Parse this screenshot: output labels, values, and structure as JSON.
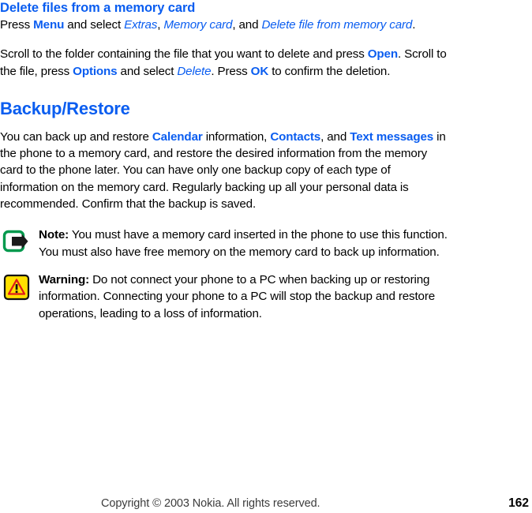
{
  "document": {
    "theme": {
      "link_blue": "#0a5df0",
      "text_black": "#000000",
      "note_icon_green": "#00994d",
      "warning_icon_yellow": "#ffe000",
      "warning_icon_red": "#e01b1b",
      "page_background": "#ffffff"
    }
  },
  "section_delete": {
    "heading": "Delete files from a memory card",
    "paragraph1": {
      "t1": "Press ",
      "menu": "Menu",
      "t2": " and select ",
      "extras": "Extras",
      "t3": ", ",
      "memory_card": "Memory card",
      "t4": ", and ",
      "delete_file": "Delete file from memory card",
      "t5": "."
    },
    "paragraph2": {
      "t1": "Scroll to the folder containing the file that you want to delete and press ",
      "open": "Open",
      "t2": ". Scroll to the file, press ",
      "options": "Options",
      "t3": " and select ",
      "delete": "Delete",
      "t4": ". Press ",
      "ok": "OK",
      "t5": " to confirm the deletion."
    }
  },
  "section_backup": {
    "heading": "Backup/Restore",
    "paragraph1": {
      "t1": "You can back up and restore ",
      "calendar": "Calendar",
      "t2": " information, ",
      "contacts": "Contacts",
      "t3": ", and ",
      "text_messages": "Text messages",
      "t4": " in the phone to a memory card, and restore the desired information from the memory card to the phone later. You can have only one backup copy of each type of information on the memory card. Regularly backing up all your personal data is recommended. Confirm that the backup is saved."
    },
    "note": {
      "icon": "note-arrow-icon",
      "label": "Note:",
      "body": " You must have a memory card inserted in the phone to use this function. You must also have free memory on the memory card to back up information."
    },
    "warning": {
      "icon": "warning-triangle-icon",
      "label": "Warning:",
      "body": "  Do not connect your phone to a PC when backing up or restoring information. Connecting your phone to a PC will stop the backup and restore operations,   leading to a loss of information."
    }
  },
  "footer": {
    "copyright_before": "Copyright ",
    "copyright_symbol": "©",
    "copyright_after": " 2003 Nokia. All rights reserved.",
    "page_number": "162"
  }
}
